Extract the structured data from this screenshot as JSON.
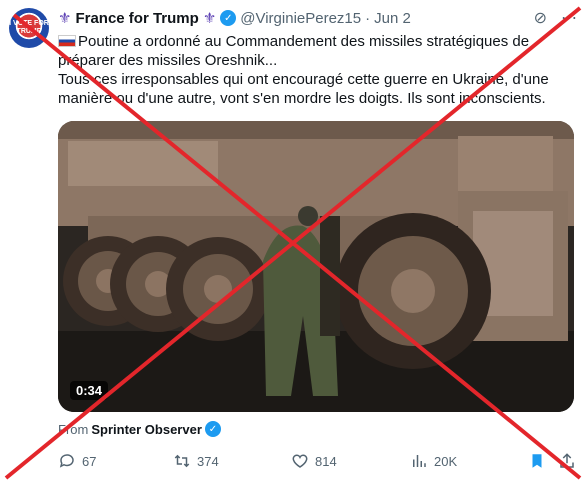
{
  "header": {
    "display_name": "France for Trump",
    "handle": "@VirginiePerez15",
    "separator": "·",
    "date": "Jun 2",
    "name_emoji": "⚜",
    "avatar_text": "I VOTE FOR TRUMP"
  },
  "tweet": {
    "line1": "Poutine a ordonné au Commandement des missiles stratégiques de préparer des missiles Oreshnik...",
    "line2": "Tous ces irresponsables qui ont encouragé cette guerre en Ukraine, d'une manière ou d'une autre, vont s'en mordre les doigts. Ils sont inconscients."
  },
  "media": {
    "duration": "0:34"
  },
  "from": {
    "prefix": "From",
    "source": "Sprinter Observer"
  },
  "actions": {
    "replies": "67",
    "reposts": "374",
    "likes": "814",
    "views": "20K"
  },
  "colors": {
    "accent": "#1d9bf0",
    "cross": "#e3262b",
    "muted": "#536471",
    "fleur": "#5b3fb3"
  }
}
